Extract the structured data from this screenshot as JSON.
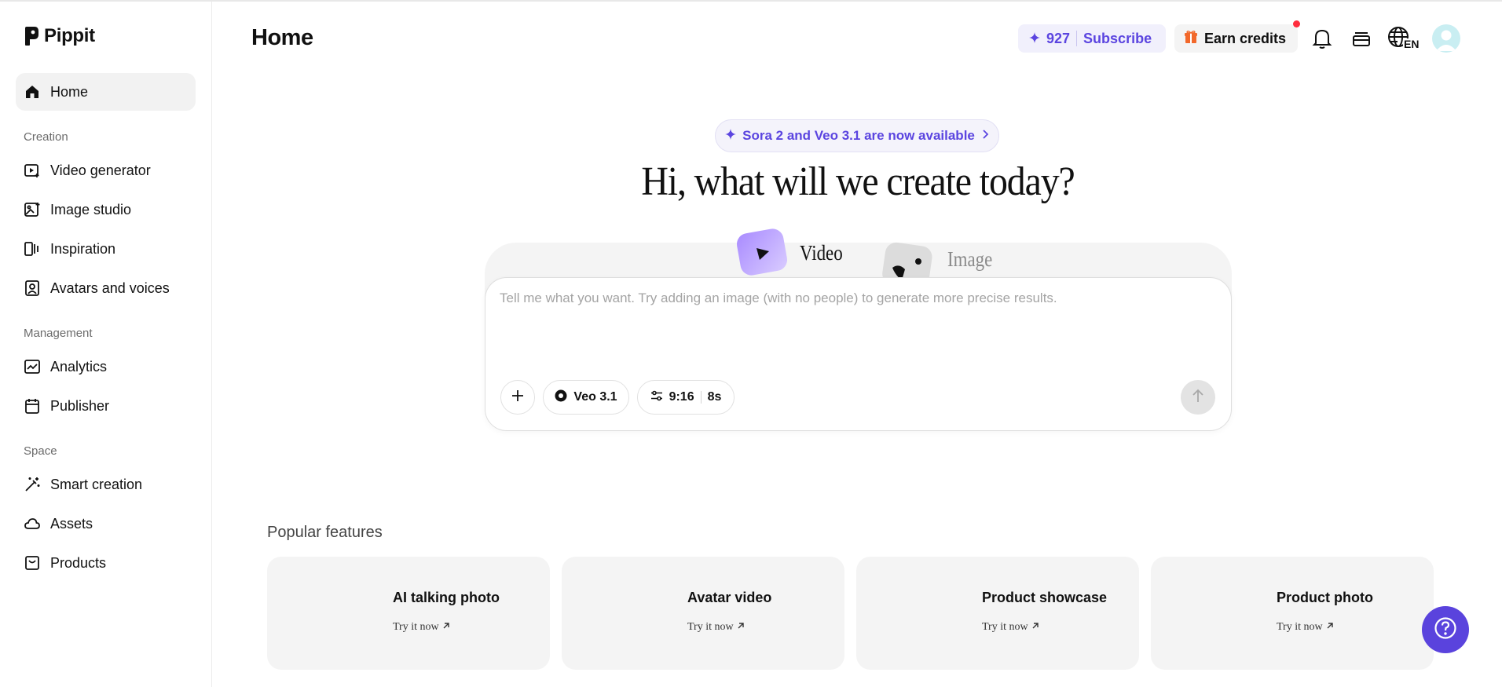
{
  "brand": {
    "name": "Pippit"
  },
  "sidebar": {
    "home": {
      "label": "Home"
    },
    "sections": [
      {
        "label": "Creation",
        "items": [
          {
            "label": "Video generator",
            "icon": "video-generator-icon"
          },
          {
            "label": "Image studio",
            "icon": "image-studio-icon"
          },
          {
            "label": "Inspiration",
            "icon": "inspiration-icon"
          },
          {
            "label": "Avatars and voices",
            "icon": "avatar-voice-icon"
          }
        ]
      },
      {
        "label": "Management",
        "items": [
          {
            "label": "Analytics",
            "icon": "analytics-icon"
          },
          {
            "label": "Publisher",
            "icon": "calendar-icon"
          }
        ]
      },
      {
        "label": "Space",
        "items": [
          {
            "label": "Smart creation",
            "icon": "magic-wand-icon"
          },
          {
            "label": "Assets",
            "icon": "cloud-icon"
          },
          {
            "label": "Products",
            "icon": "bag-icon"
          }
        ]
      }
    ]
  },
  "header": {
    "title": "Home",
    "credits": "927",
    "subscribe_label": "Subscribe",
    "earn_label": "Earn credits",
    "language": "EN"
  },
  "hero": {
    "announcement": "Sora 2 and Veo 3.1 are now available",
    "headline": "Hi, what will we create today?",
    "tabs": [
      {
        "label": "Video",
        "active": true
      },
      {
        "label": "Image",
        "active": false
      }
    ]
  },
  "composer": {
    "placeholder": "Tell me what you want. Try adding an image (with no people) to generate more precise results.",
    "value": "",
    "model": "Veo 3.1",
    "ratio": "9:16",
    "duration": "8s"
  },
  "popular": {
    "title": "Popular features",
    "cards": [
      {
        "title": "AI talking photo",
        "cta": "Try it now"
      },
      {
        "title": "Avatar video",
        "cta": "Try it now"
      },
      {
        "title": "Product showcase",
        "cta": "Try it now"
      },
      {
        "title": "Product photo",
        "cta": "Try it now"
      }
    ]
  },
  "colors": {
    "accent": "#5b45e0",
    "help_button": "#5a43dd",
    "notification_dot": "#ff2d3d",
    "earn_gift": "#f2682a"
  }
}
